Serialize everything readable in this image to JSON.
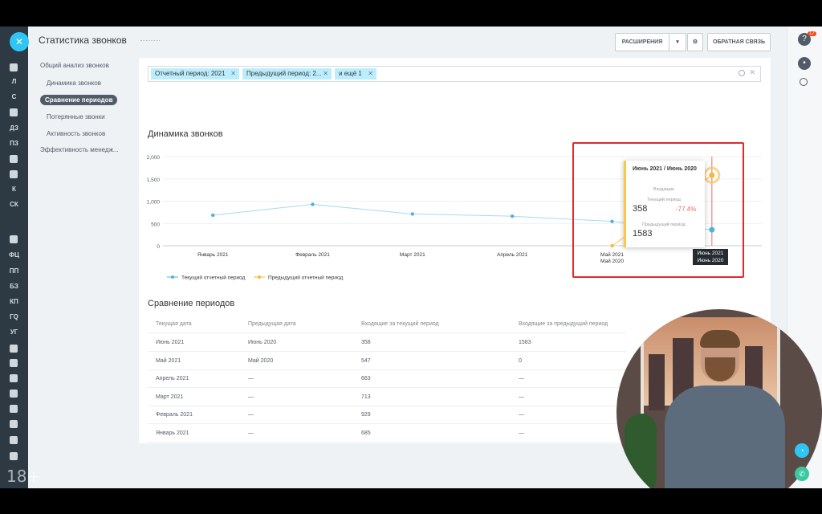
{
  "header": {
    "title": "Статистика звонков",
    "extensions_label": "РАСШИРЕНИЯ",
    "feedback_label": "ОБРАТНАЯ СВЯЗЬ"
  },
  "left_rail": {
    "items": [
      "Л",
      "С",
      "ДЗ",
      "ПЗ",
      "К",
      "СК",
      "ФЦ",
      "ПП",
      "БЗ",
      "КП",
      "ГQ",
      "УГ"
    ]
  },
  "right_rail": {
    "notifications_badge": "17"
  },
  "menu": {
    "items": [
      {
        "label": "Общий анализ звонков"
      },
      {
        "label": "Динамика звонков"
      },
      {
        "label": "Сравнение периодов",
        "active": true
      },
      {
        "label": "Потерянные звонки"
      },
      {
        "label": "Активность звонков"
      },
      {
        "label": "Эффективность менедж..."
      }
    ]
  },
  "filter": {
    "chips": [
      "Отчетный период: 2021",
      "Предыдущий период: 2...",
      "и ещё 1"
    ]
  },
  "dynamics": {
    "title": "Динамика звонков"
  },
  "chart_data": {
    "type": "line",
    "categories": [
      "Январь 2021",
      "Февраль 2021",
      "Март 2021",
      "Апрель 2021",
      "Май 2021",
      "Июнь 2021"
    ],
    "category_sub": [
      "",
      "",
      "",
      "",
      "Май 2020",
      "Июнь 2020"
    ],
    "series": [
      {
        "name": "Текущий отчетный период",
        "color": "#4fb3d9",
        "values": [
          685,
          929,
          713,
          663,
          547,
          358
        ]
      },
      {
        "name": "Предыдущий отчетный период",
        "color": "#f6b93b",
        "values": [
          null,
          null,
          null,
          null,
          0,
          1583
        ]
      }
    ],
    "yticks": [
      "2,000",
      "1,500",
      "1,000",
      "500",
      "0"
    ],
    "ylim": [
      0,
      2000
    ]
  },
  "tooltip": {
    "title": "Июнь 2021 / Июнь 2020",
    "incoming": "Входящие",
    "current_label": "Текущий период",
    "current_value": "358",
    "change": "-77.4%",
    "previous_label": "Предыдущий период",
    "previous_value": "1583",
    "x_label_1": "Июнь 2021",
    "x_label_2": "Июнь 2020"
  },
  "comparison": {
    "title": "Сравнение периодов",
    "columns": [
      "Текущая дата",
      "Предыдущая дата",
      "Входящие за текущий период",
      "Входящие за предыдущий период"
    ],
    "rows": [
      [
        "Июнь 2021",
        "Июнь 2020",
        "358",
        "1583"
      ],
      [
        "Май 2021",
        "Май 2020",
        "547",
        "0"
      ],
      [
        "Апрель 2021",
        "—",
        "663",
        "—"
      ],
      [
        "Март 2021",
        "—",
        "713",
        "—"
      ],
      [
        "Февраль 2021",
        "—",
        "929",
        "—"
      ],
      [
        "Январь 2021",
        "—",
        "685",
        "—"
      ]
    ]
  },
  "watermark": "18+"
}
